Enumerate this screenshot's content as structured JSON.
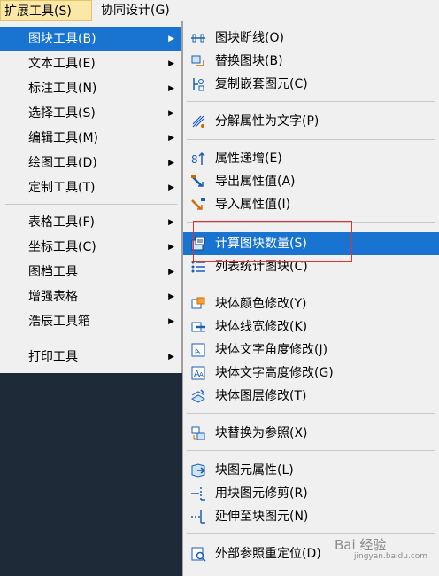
{
  "menubar": [
    {
      "label": "扩展工具(S)",
      "active": true
    },
    {
      "label": "协同设计(G)",
      "active": false
    }
  ],
  "menu1": {
    "items": [
      {
        "label": "图块工具(B)"
      },
      {
        "label": "文本工具(E)"
      },
      {
        "label": "标注工具(N)"
      },
      {
        "label": "选择工具(S)"
      },
      {
        "label": "编辑工具(M)"
      },
      {
        "label": "绘图工具(D)"
      },
      {
        "label": "定制工具(T)"
      },
      {
        "label": "表格工具(F)"
      },
      {
        "label": "坐标工具(C)"
      },
      {
        "label": "图档工具"
      },
      {
        "label": "增强表格"
      },
      {
        "label": "浩辰工具箱"
      },
      {
        "label": "打印工具"
      }
    ]
  },
  "menu2": {
    "items": [
      {
        "label": "图块断线(O)",
        "icon": "block-break-icon"
      },
      {
        "label": "替换图块(B)",
        "icon": "replace-block-icon"
      },
      {
        "label": "复制嵌套图元(C)",
        "icon": "copy-nested-icon"
      },
      {
        "label": "分解属性为文字(P)",
        "icon": "explode-attr-icon"
      },
      {
        "label": "属性递增(E)",
        "icon": "attr-increment-icon"
      },
      {
        "label": "导出属性值(A)",
        "icon": "export-attr-icon"
      },
      {
        "label": "导入属性值(I)",
        "icon": "import-attr-icon"
      },
      {
        "label": "计算图块数量(S)",
        "icon": "count-blocks-icon"
      },
      {
        "label": "列表统计图块(C)",
        "icon": "list-blocks-icon"
      },
      {
        "label": "块体颜色修改(Y)",
        "icon": "block-color-icon"
      },
      {
        "label": "块体线宽修改(K)",
        "icon": "block-linewidth-icon"
      },
      {
        "label": "块体文字角度修改(J)",
        "icon": "block-text-angle-icon"
      },
      {
        "label": "块体文字高度修改(G)",
        "icon": "block-text-height-icon"
      },
      {
        "label": "块体图层修改(T)",
        "icon": "block-layer-icon"
      },
      {
        "label": "块替换为参照(X)",
        "icon": "block-to-xref-icon"
      },
      {
        "label": "块图元属性(L)",
        "icon": "block-entity-prop-icon"
      },
      {
        "label": "用块图元修剪(R)",
        "icon": "trim-by-block-icon"
      },
      {
        "label": "延伸至块图元(N)",
        "icon": "extend-to-block-icon"
      },
      {
        "label": "外部参照重定位(D)",
        "icon": "xref-relocate-icon"
      }
    ]
  },
  "watermark": {
    "text": "Bai 经验",
    "sub": "jingyan.baidu.com"
  },
  "colors": {
    "highlight": "#1874d0",
    "menu_bg": "#f0f0f0",
    "desktop_bg": "#1f2a38",
    "annotation": "#e03030"
  }
}
